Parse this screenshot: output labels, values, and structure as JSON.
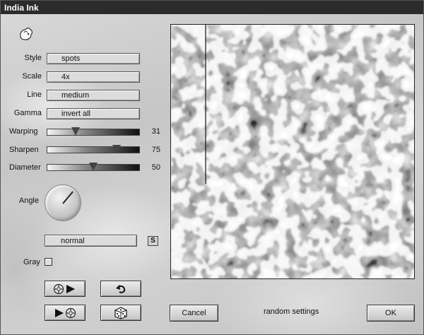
{
  "window": {
    "title": "India Ink"
  },
  "controls": {
    "style": {
      "label": "Style",
      "value": "spots"
    },
    "scale": {
      "label": "Scale",
      "value": "4x"
    },
    "line": {
      "label": "Line",
      "value": "medium"
    },
    "gamma": {
      "label": "Gamma",
      "value": "invert all"
    }
  },
  "sliders": {
    "warping": {
      "label": "Warping",
      "value": "31",
      "level": 0.31
    },
    "sharpen": {
      "label": "Sharpen",
      "value": "75",
      "level": 0.75
    },
    "diameter": {
      "label": "Diameter",
      "value": "50",
      "level": 0.5
    }
  },
  "angle": {
    "label": "Angle"
  },
  "blend_mode": {
    "value": "normal",
    "s_button_label": "S"
  },
  "gray": {
    "label": "Gray"
  },
  "buttons": {
    "cancel": "Cancel",
    "ok": "OK"
  },
  "status": {
    "random_settings": "random settings"
  },
  "icons": {
    "logo": "hand-logo-icon",
    "play_forward": "film-play-forward-icon",
    "play_back": "film-play-back-icon",
    "undo": "undo-arrow-icon",
    "random": "dice-icon"
  }
}
